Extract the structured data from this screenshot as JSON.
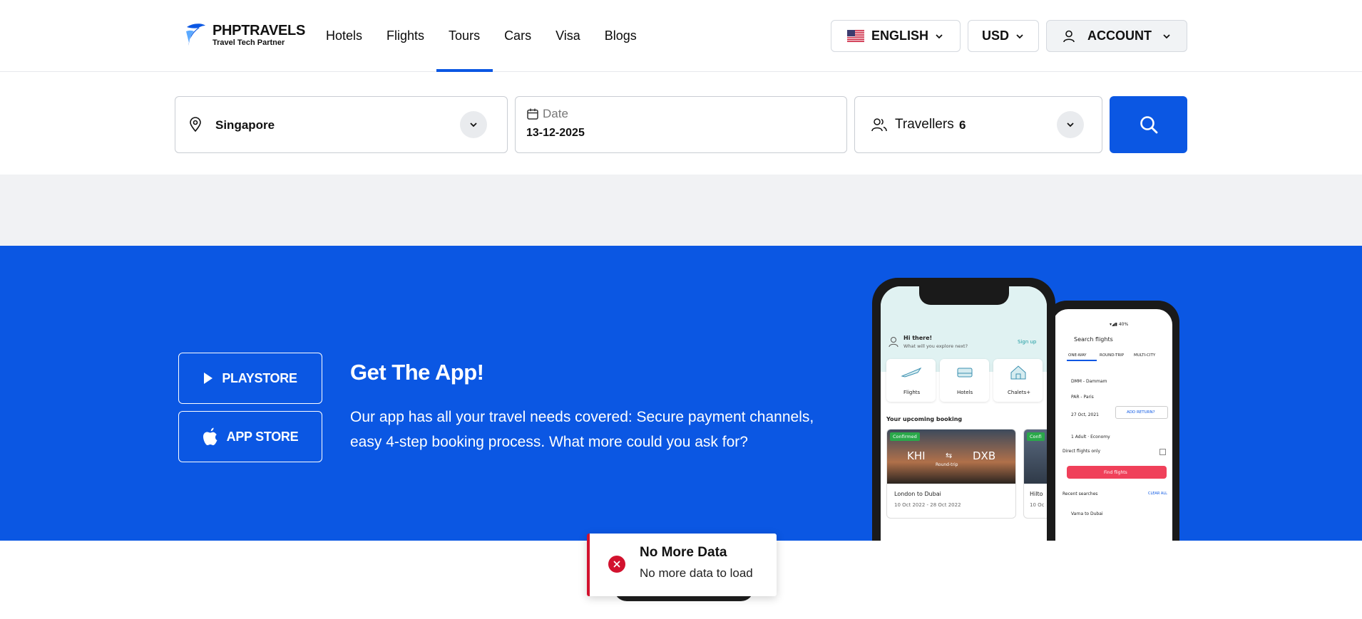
{
  "brand": {
    "name": "PHPTRAVELS",
    "tagline": "Travel Tech Partner"
  },
  "nav": {
    "items": [
      {
        "label": "Hotels",
        "active": false
      },
      {
        "label": "Flights",
        "active": false
      },
      {
        "label": "Tours",
        "active": true
      },
      {
        "label": "Cars",
        "active": false
      },
      {
        "label": "Visa",
        "active": false
      },
      {
        "label": "Blogs",
        "active": false
      }
    ]
  },
  "header": {
    "language": "ENGLISH",
    "currency": "USD",
    "account": "ACCOUNT"
  },
  "search": {
    "location": "Singapore",
    "date_label": "Date",
    "date_value": "13-12-2025",
    "travellers_label": "Travellers",
    "travellers_value": "6"
  },
  "app_promo": {
    "playstore": "PLAYSTORE",
    "appstore": "APP STORE",
    "title": "Get The App!",
    "text": "Our app has all your travel needs covered: Secure payment channels, easy 4-step booking process. What more could you ask for?"
  },
  "phone_front": {
    "greeting": "Hi there!",
    "subgreeting": "What will you explore next?",
    "signup": "Sign up",
    "categories": [
      "Flights",
      "Hotels",
      "Chalets+"
    ],
    "upcoming": "Your upcoming booking",
    "badge": "Confirmed",
    "from": "KHI",
    "to": "DXB",
    "trip_type": "Round-trip",
    "route": "London to Dubai",
    "dates": "10 Oct 2022 - 28 Oct 2022",
    "second_card": "Hilto",
    "second_dates": "10 Oc"
  },
  "phone_back": {
    "title": "Search flights",
    "tabs": [
      "ONE-WAY",
      "ROUND-TRIP",
      "MULTI-CITY"
    ],
    "from_value": "DMM - Dammam",
    "to_value": "PAR - Paris",
    "date_value": "27 Oct, 2021",
    "add_return": "ADD RETURN?",
    "passengers": "1 Adult · Economy",
    "direct": "Direct flights only",
    "find": "Find flights",
    "recent": "Recent searches",
    "clear": "CLEAR ALL",
    "recent_item": "Varna to Dubai"
  },
  "toast": {
    "title": "No More Data",
    "message": "No more data to load"
  },
  "colors": {
    "primary": "#0b57e3",
    "error": "#d2122e",
    "pink": "#f0405a"
  },
  "icons": [
    "logo-icon",
    "chevron-down-icon",
    "flag-us-icon",
    "user-icon",
    "location-pin-icon",
    "calendar-icon",
    "travellers-icon",
    "search-icon",
    "play-icon",
    "apple-icon",
    "close-icon"
  ]
}
